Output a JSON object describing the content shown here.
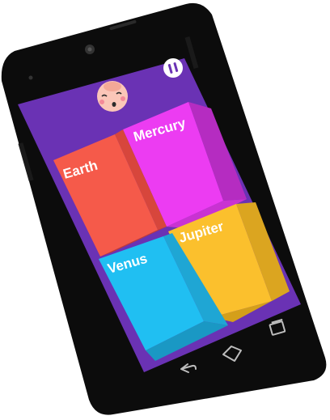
{
  "app": {
    "avatar": {
      "icon": "baby-face-icon"
    },
    "pause_button": {
      "icon": "pause-icon"
    },
    "tiles": [
      {
        "id": "earth",
        "label": "Earth",
        "color": "#f55a4a"
      },
      {
        "id": "mercury",
        "label": "Mercury",
        "color": "#ec3cf2"
      },
      {
        "id": "venus",
        "label": "Venus",
        "color": "#20bff2"
      },
      {
        "id": "jupiter",
        "label": "Jupiter",
        "color": "#fbc02d"
      }
    ]
  },
  "device": {
    "nav_buttons": [
      {
        "id": "back",
        "icon": "back-arrow-icon"
      },
      {
        "id": "home",
        "icon": "home-icon"
      },
      {
        "id": "recents",
        "icon": "recents-icon"
      }
    ]
  },
  "colors": {
    "screen_bg": "#6a32b4",
    "phone_body": "#0c0c0c"
  }
}
